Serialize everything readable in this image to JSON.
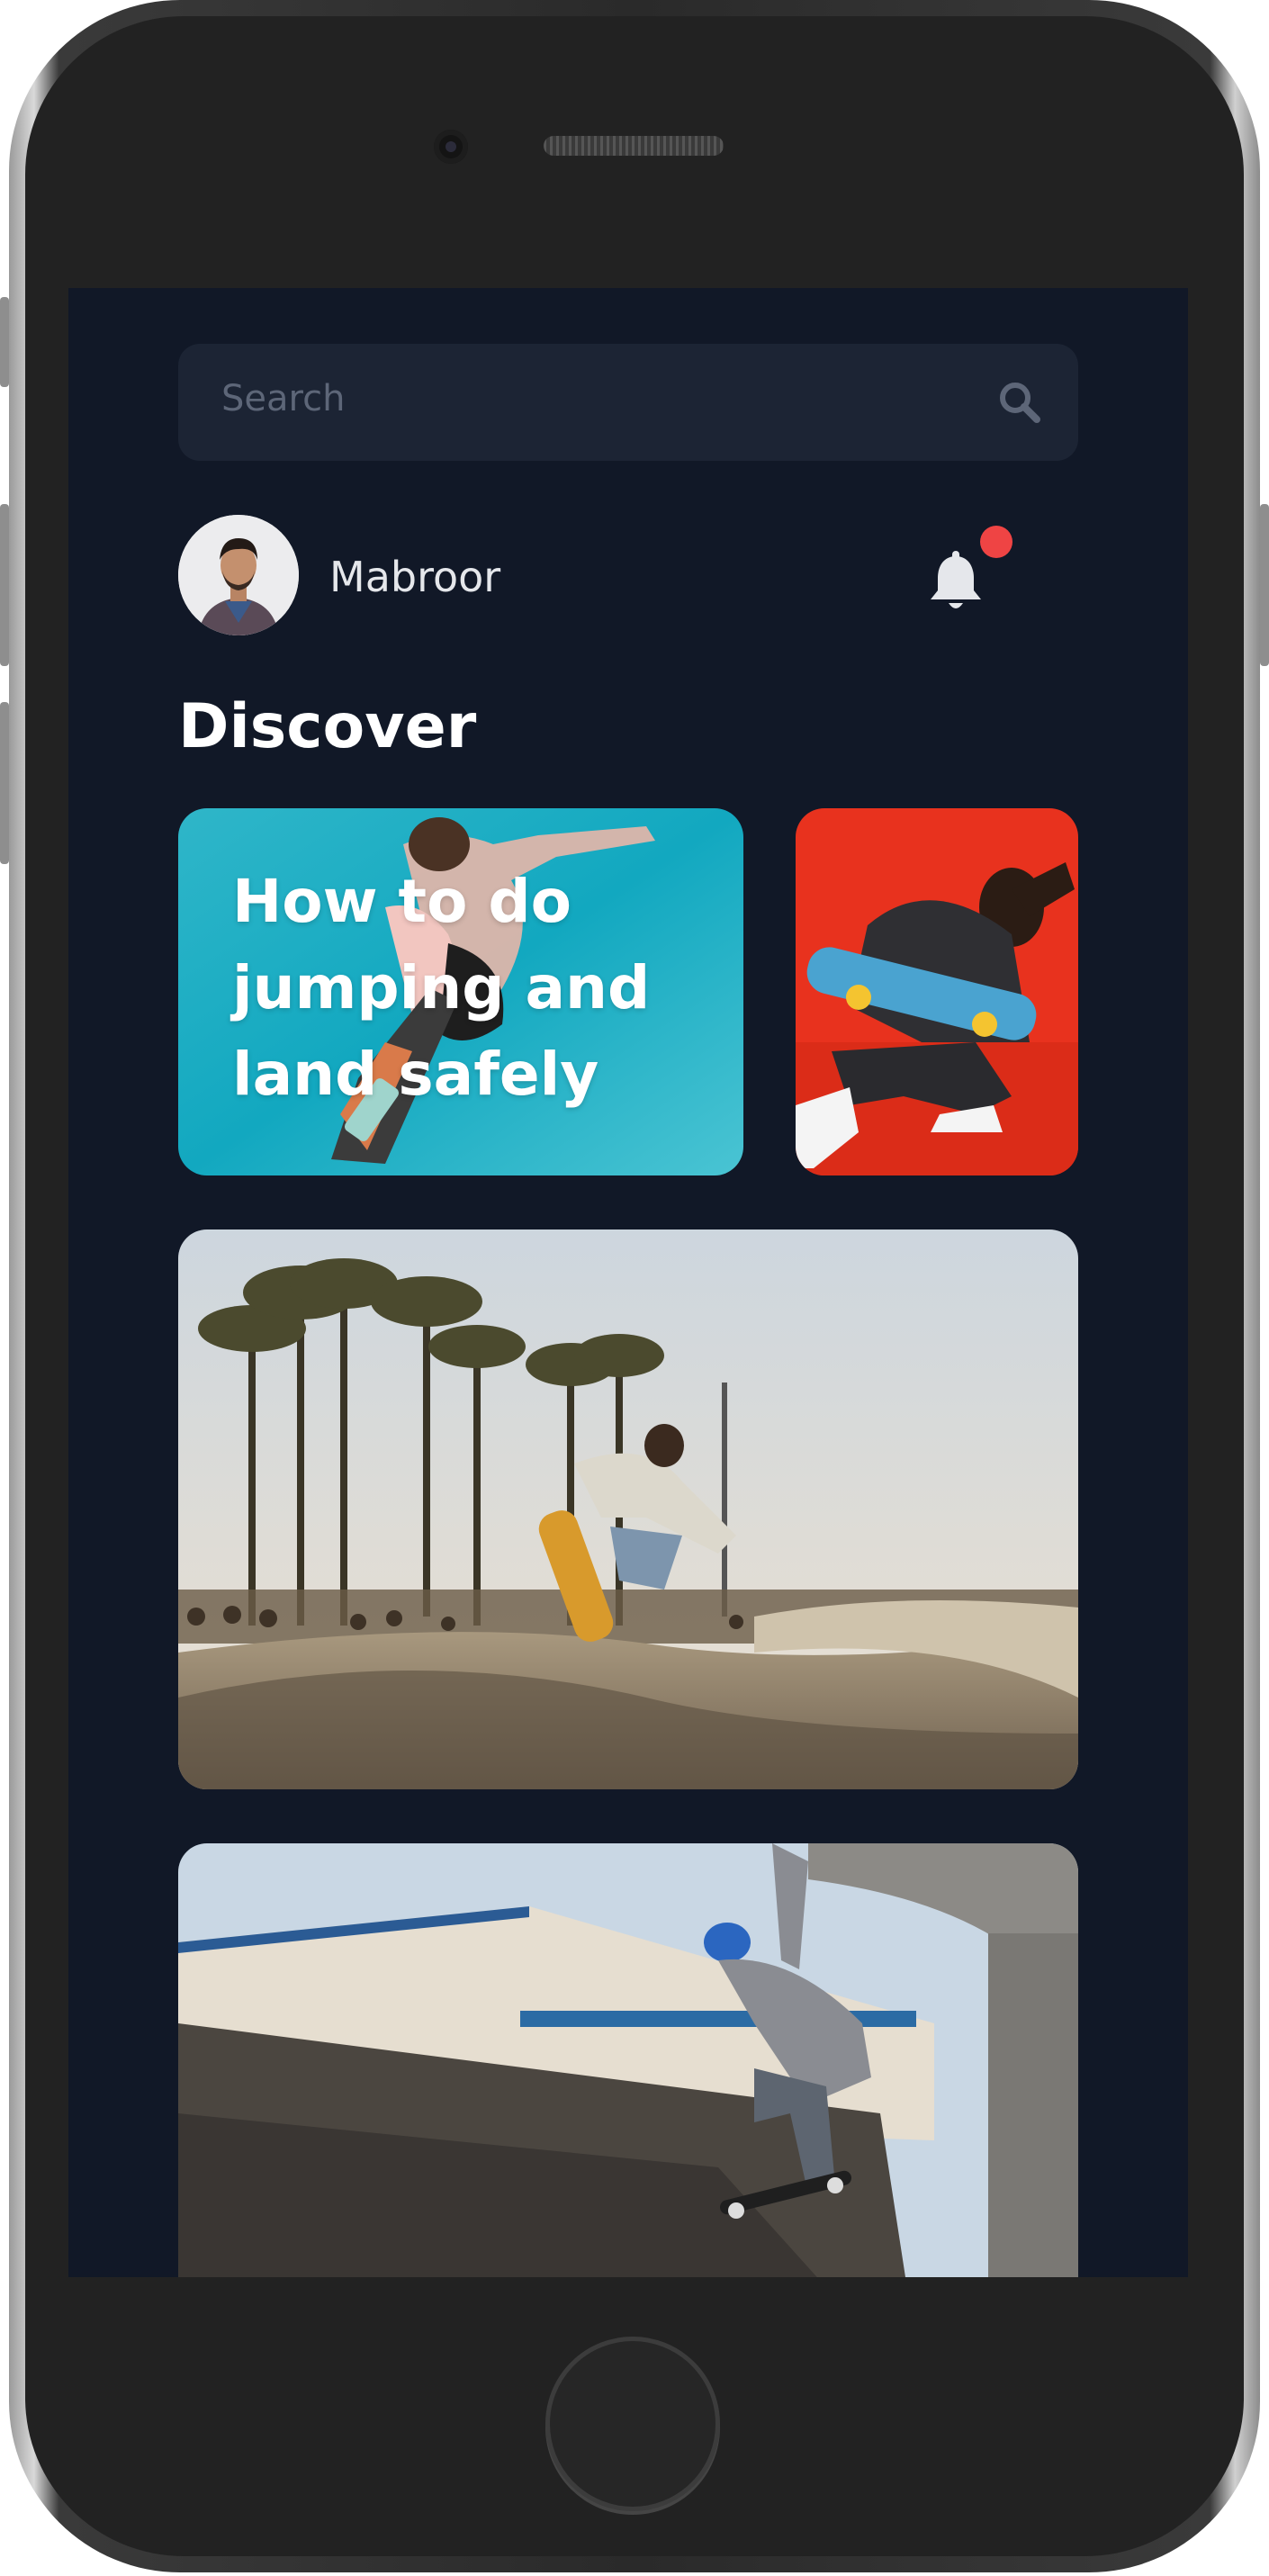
{
  "search": {
    "placeholder": "Search"
  },
  "user": {
    "name": "Mabroor"
  },
  "notifications": {
    "has_unread": true
  },
  "section": {
    "title": "Discover"
  },
  "cards": [
    {
      "title": "How to do jumping and land safely"
    },
    {
      "title": ""
    },
    {
      "title": ""
    },
    {
      "title": ""
    }
  ],
  "colors": {
    "screen_bg": "#111827",
    "search_bg": "#1c2434",
    "notification_dot": "#ef4444",
    "text_primary": "#ffffff"
  },
  "icons": [
    "search-icon",
    "bell-icon"
  ]
}
